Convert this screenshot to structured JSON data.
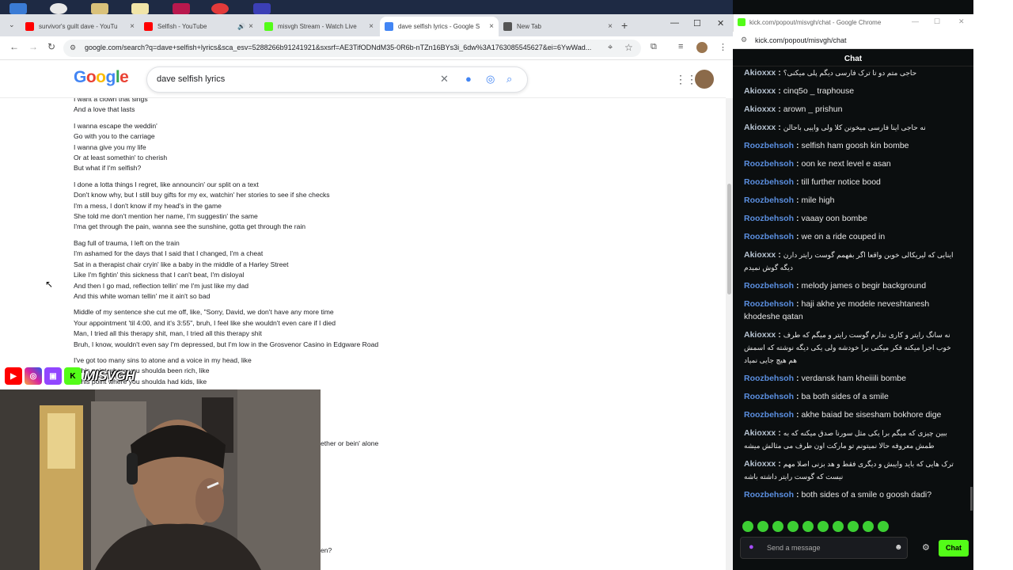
{
  "left_browser": {
    "tabs": [
      {
        "title": "survivor's guilt dave - YouTu",
        "favicon": "youtube-icon",
        "color": "#ff0000"
      },
      {
        "title": "Selfish - YouTube",
        "favicon": "youtube-icon",
        "color": "#ff0000",
        "audio": true
      },
      {
        "title": "misvgh Stream - Watch Live",
        "favicon": "kick-icon",
        "color": "#53fc18"
      },
      {
        "title": "dave selfish lyrics - Google S",
        "favicon": "google-icon",
        "color": "#4285f4",
        "active": true
      },
      {
        "title": "New Tab",
        "favicon": "chrome-icon",
        "color": "#555555"
      }
    ],
    "new_tab_symbol": "+",
    "url": "google.com/search?q=dave+selfish+lyrics&sca_esv=5288266b91241921&sxsrf=AE3TifODNdM35-0R6b-nTZn16BYs3i_6dw%3A1763085545627&ei=6YwWad..."
  },
  "google": {
    "logo": "Google",
    "query": "dave selfish lyrics"
  },
  "lyrics": [
    [
      "I want a clown that sings",
      "And a love that lasts"
    ],
    [
      "I wanna escape the weddin'",
      "Go with you to the carriage",
      "I wanna give you my life",
      "Or at least somethin' to cherish",
      "But what if I'm selfish?"
    ],
    [
      "I done a lotta things I regret, like announcin' our split on a text",
      "Don't know why, but I still buy gifts for my ex, watchin' her stories to see if she checks",
      "I'm a mess, I don't know if my head's in the game",
      "She told me don't mention her name, I'm suggestin' the same",
      "I'ma get through the pain, wanna see the sunshine, gotta get through the rain"
    ],
    [
      "Bag full of trauma, I left on the train",
      "I'm ashamed for the days that I said that I changed, I'm a cheat",
      "Sat in a therapist chair cryin' like a baby in the middle of a Harley Street",
      "Like I'm fightin' this sickness that I can't beat, I'm disloyal",
      "And then I go mad, reflection tellin' me I'm just like my dad",
      "And this white woman tellin' me it ain't so bad"
    ],
    [
      "Middle of my sentence she cut me off, like, \"Sorry, David, we don't have any more time",
      "Your appointment 'til 4:00, and it's 3:55\", bruh, I feel like she wouldn't even care if I died",
      "Man, I tried all this therapy shit, man, I tried all this therapy shit",
      "Bruh, I know, wouldn't even say I'm depressed, but I'm low in the Grosvenor Casino in Edgware Road"
    ],
    [
      "I've got too many sins to atone and a voice in my head, like",
      "...this point where you shoulda been rich, like",
      "...this point where you shoulda had kids, like"
    ]
  ],
  "lyrics_fragments": [
    "ether or bein' alone",
    "en?"
  ],
  "overlay": {
    "brand": "MISVGH"
  },
  "chat_window": {
    "title": "kick.com/popout/misvgh/chat - Google Chrome",
    "url": "kick.com/popout/misvgh/chat",
    "header": "Chat",
    "messages": [
      {
        "user": "Akioxxx",
        "color": "#b7c3d1",
        "text": "حاجی متم دو تا ترک فارسی دیگم پلی میکنی؟"
      },
      {
        "user": "Akioxxx",
        "color": "#b7c3d1",
        "text": "cinq5o _ traphouse"
      },
      {
        "user": "Akioxxx",
        "color": "#b7c3d1",
        "text": "arown _ prishun"
      },
      {
        "user": "Akioxxx",
        "color": "#b7c3d1",
        "text": "نه حاجی اینا فارسی میخونن کلا ولی واییی باحالن"
      },
      {
        "user": "Roozbehsoh",
        "color": "#5b8fe0",
        "text": "selfish ham goosh kin bombe"
      },
      {
        "user": "Roozbehsoh",
        "color": "#5b8fe0",
        "text": "oon ke next level e asan"
      },
      {
        "user": "Roozbehsoh",
        "color": "#5b8fe0",
        "text": "till further notice bood"
      },
      {
        "user": "Roozbehsoh",
        "color": "#5b8fe0",
        "text": "mile high"
      },
      {
        "user": "Roozbehsoh",
        "color": "#5b8fe0",
        "text": "vaaay oon bombe"
      },
      {
        "user": "Roozbehsoh",
        "color": "#5b8fe0",
        "text": "we on a ride couped in"
      },
      {
        "user": "Akioxxx",
        "color": "#b7c3d1",
        "text": "اینایی که لیریکالی خوبن واقعا اگر بفهمم گوست رایتر دارن دیگه گوش نمیدم"
      },
      {
        "user": "Roozbehsoh",
        "color": "#5b8fe0",
        "text": "melody james o begir background"
      },
      {
        "user": "Roozbehsoh",
        "color": "#5b8fe0",
        "text": "haji akhe ye modele neveshtanesh khodeshe qatan"
      },
      {
        "user": "Akioxxx",
        "color": "#b7c3d1",
        "text": "نه سانگ رایتر و کاری ندارم گوست رایتر و میگم که طرف خوب اجرا میکنه فکر میکنی برا خودشه ولی یکی دیگه نوشته که اسمش هم هیچ جایی نمیاد"
      },
      {
        "user": "Roozbehsoh",
        "color": "#5b8fe0",
        "text": "verdansk ham kheiiili bombe"
      },
      {
        "user": "Roozbehsoh",
        "color": "#5b8fe0",
        "text": "ba both sides of a smile"
      },
      {
        "user": "Roozbehsoh",
        "color": "#5b8fe0",
        "text": "akhe baiad be sisesham bokhore dige"
      },
      {
        "user": "Akioxxx",
        "color": "#b7c3d1",
        "text": "ببین چیزی که میگم برا یکی مثل سورنا صدق میکنه که به طمش معروفه حالا نمیتونم تو مارکت اون طرف می مثالش میشه"
      },
      {
        "user": "Akioxxx",
        "color": "#b7c3d1",
        "text": "ترک هایی که باید وایبش و دیگری فقط و هد بزنی اصلا مهم نیست که گوست رایتر داشته باشه"
      },
      {
        "user": "Roozbehsoh",
        "color": "#5b8fe0",
        "text": "both sides of a smile o goosh dadi?"
      }
    ],
    "input_placeholder": "Send a message",
    "send_label": "Chat",
    "accent": "#53fc18"
  }
}
